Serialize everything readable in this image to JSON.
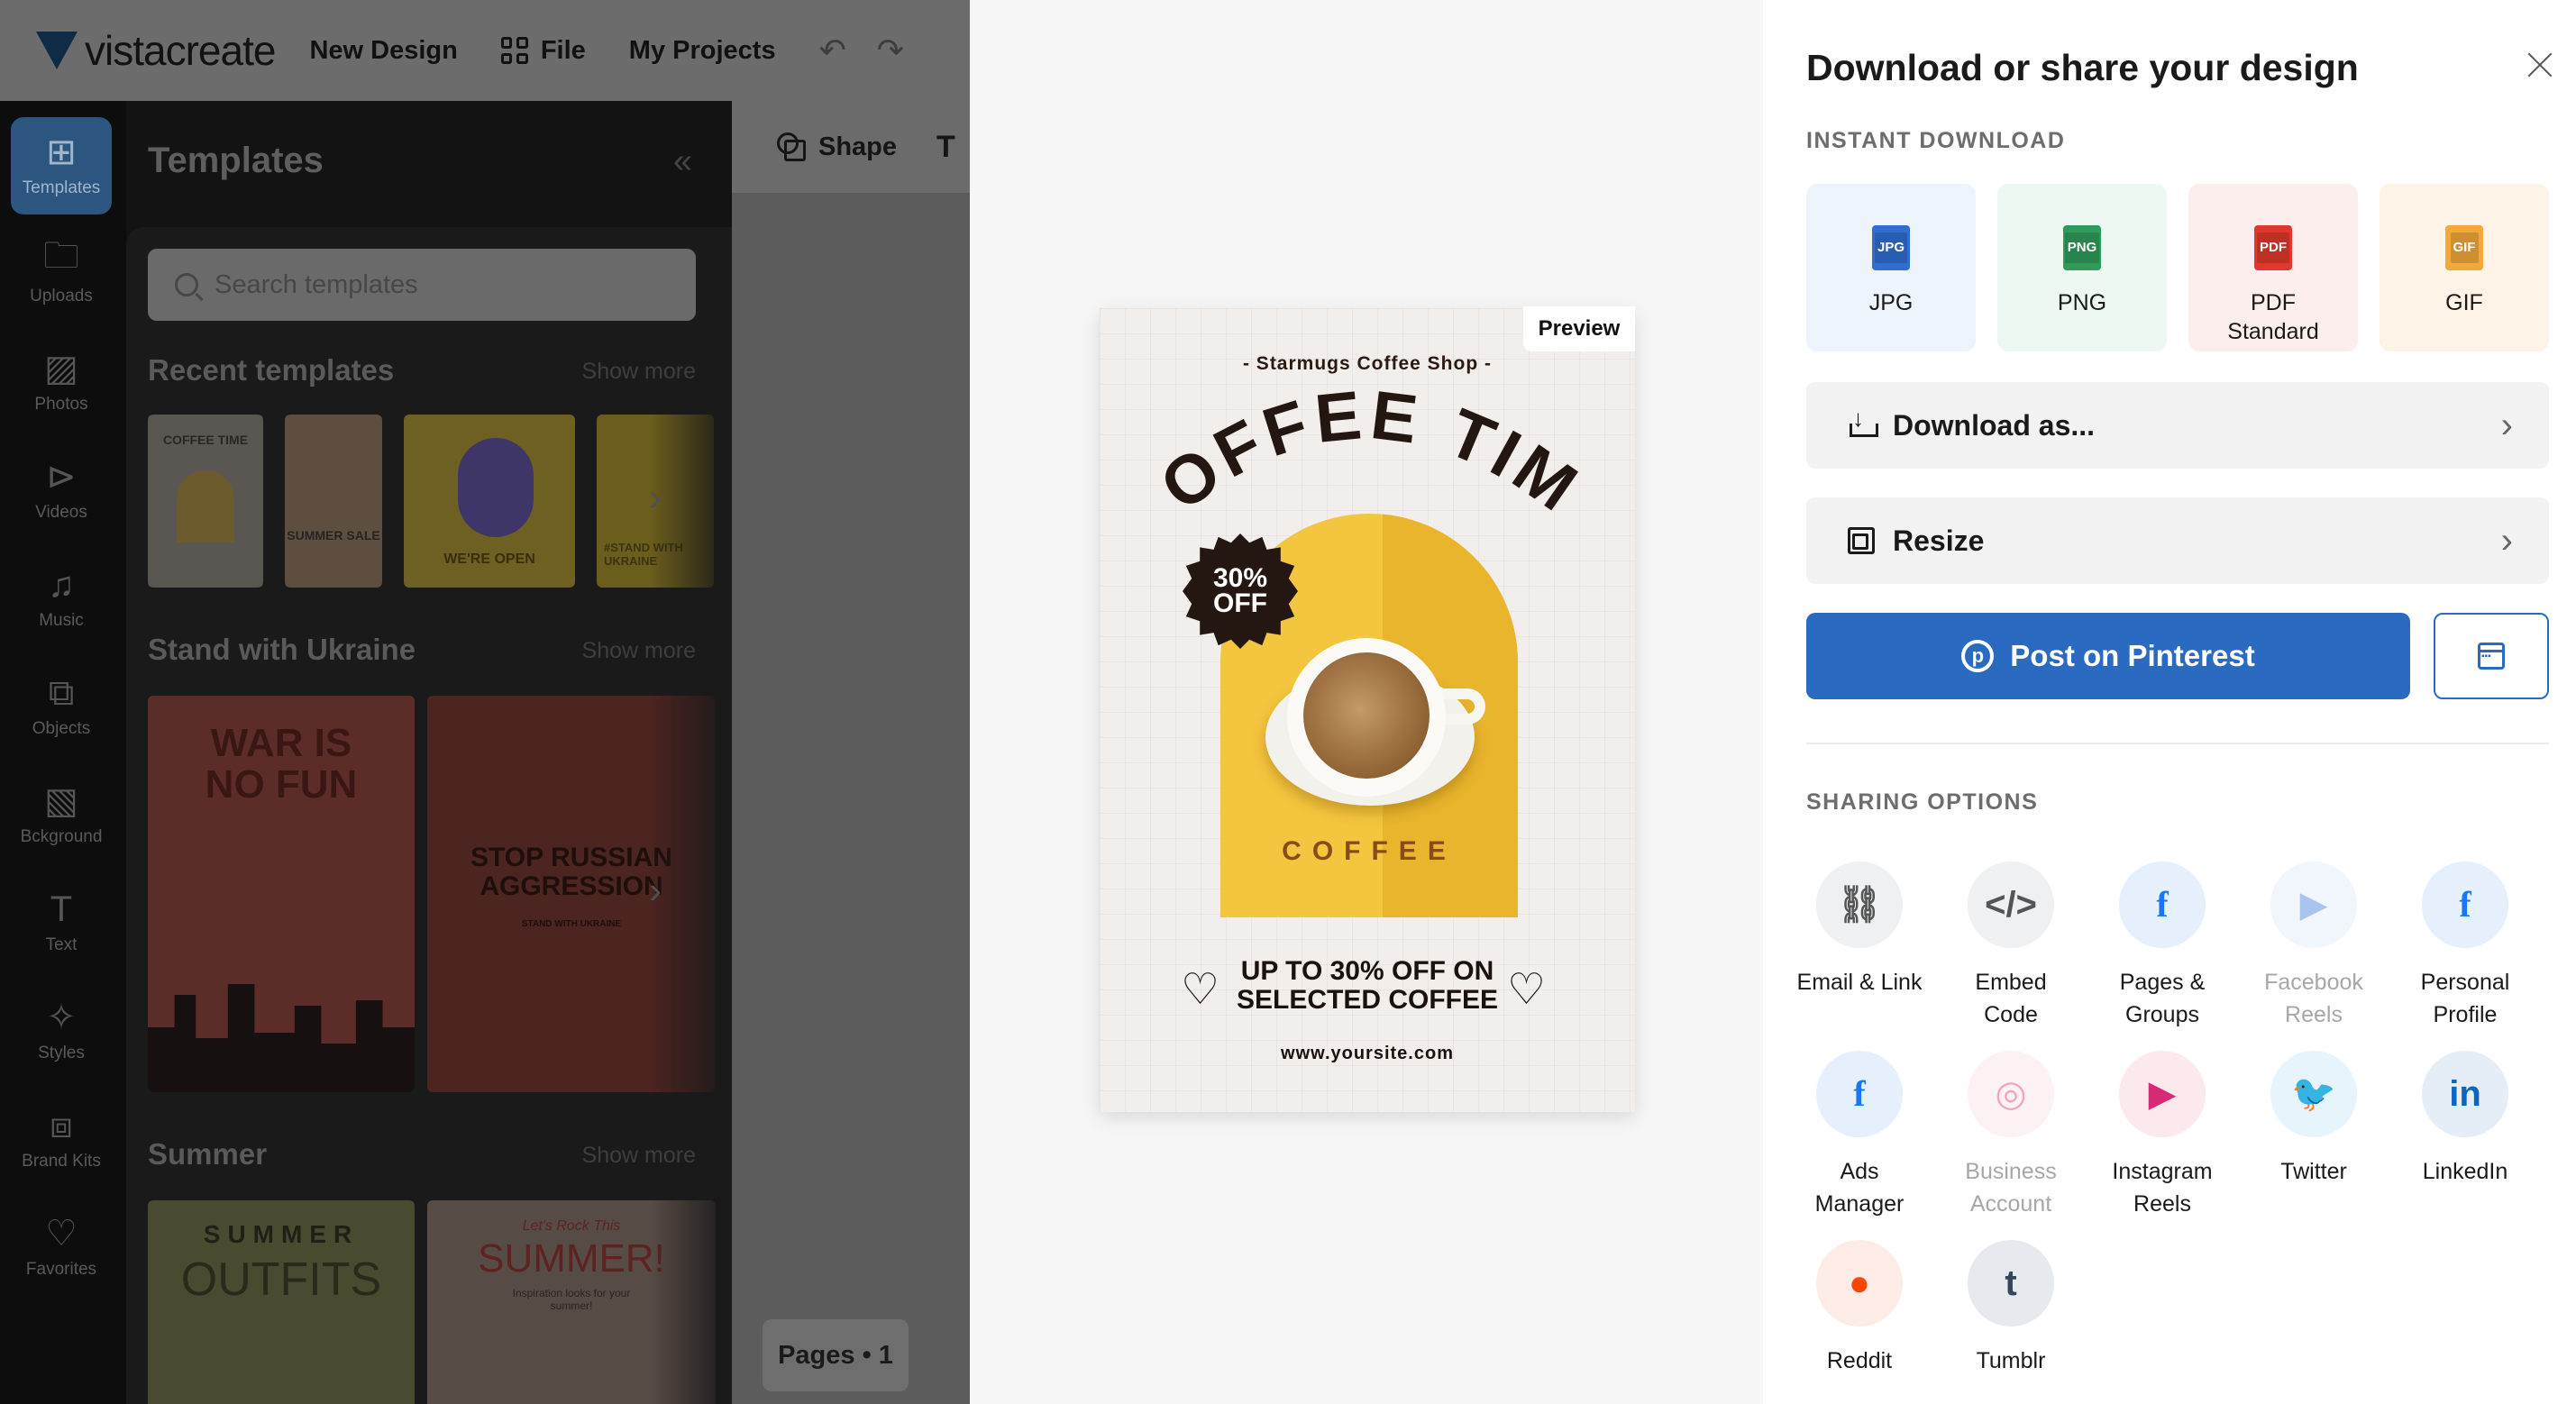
{
  "editor": {
    "logo_text": "vistacreate",
    "nav": {
      "new_design": "New Design",
      "file": "File",
      "my_projects": "My Projects"
    },
    "undo_icon": "undo-arrow-icon",
    "redo_icon": "redo-arrow-icon",
    "iconbar": [
      {
        "label": "Templates",
        "icon": "templates-icon",
        "active": true
      },
      {
        "label": "Uploads",
        "icon": "folder-icon"
      },
      {
        "label": "Photos",
        "icon": "image-icon"
      },
      {
        "label": "Videos",
        "icon": "video-icon"
      },
      {
        "label": "Music",
        "icon": "music-note-icon"
      },
      {
        "label": "Objects",
        "icon": "shapes-icon"
      },
      {
        "label": "Bckground",
        "icon": "background-icon"
      },
      {
        "label": "Text",
        "icon": "text-icon"
      },
      {
        "label": "Styles",
        "icon": "sparkle-icon"
      },
      {
        "label": "Brand Kits",
        "icon": "briefcase-icon"
      },
      {
        "label": "Favorites",
        "icon": "heart-icon"
      }
    ],
    "templates_panel": {
      "title": "Templates",
      "search_placeholder": "Search templates",
      "sections": [
        {
          "title": "Recent templates",
          "more": "Show more"
        },
        {
          "title": "Stand with Ukraine",
          "more": "Show more"
        },
        {
          "title": "Summer",
          "more": "Show more"
        }
      ],
      "recent_thumb_texts": [
        "COFFEE TIME",
        "SUMMER SALE",
        "WE'RE OPEN",
        "#STAND WITH UKRAINE"
      ],
      "ukraine_thumb_texts": [
        "WAR IS NO FUN",
        "STOP RUSSIAN AGGRESSION",
        "STAND WITH UKRAINE"
      ],
      "summer_thumb_texts": [
        "SUMMER",
        "OUTFITS",
        "Let's Rock This",
        "SUMMER!",
        "Inspiration looks for your summer!"
      ]
    },
    "toolbar": {
      "shape": "Shape"
    },
    "pages": "Pages • 1"
  },
  "preview": {
    "badge": "Preview",
    "poster": {
      "shop": "- Starmugs Coffee Shop -",
      "headline": "COFFEE TIME",
      "discount_line1": "30%",
      "discount_line2": "OFF",
      "arch_word": "COFFEE",
      "promo_line1": "UP TO 30% OFF ON",
      "promo_line2": "SELECTED COFFEE",
      "site": "www.yoursite.com"
    }
  },
  "share_panel": {
    "title": "Download or share your design",
    "instant_download_label": "INSTANT DOWNLOAD",
    "formats": [
      {
        "label": "JPG",
        "badge": "JPG",
        "bg": "#eef4fb",
        "icon_color": "#2f6fd0",
        "icon": "jpg-file-icon"
      },
      {
        "label": "PNG",
        "badge": "PNG",
        "bg": "#ecf8f1",
        "icon_color": "#2f9a5a",
        "icon": "png-file-icon"
      },
      {
        "label": "PDF\nStandard",
        "badge": "PDF",
        "bg": "#fdeeee",
        "icon_color": "#e0392b",
        "icon": "pdf-file-icon"
      },
      {
        "label": "GIF",
        "badge": "GIF",
        "bg": "#fdf3e6",
        "icon_color": "#f2a93b",
        "icon": "gif-file-icon"
      }
    ],
    "download_as": "Download as...",
    "resize": "Resize",
    "post_pinterest": "Post on Pinterest",
    "sharing_options_label": "SHARING OPTIONS",
    "share_options": [
      {
        "label": "Email & Link",
        "icon": "link-icon",
        "glyph": "⛓",
        "bg": "#eef0f2",
        "fg": "#555555",
        "dim": false
      },
      {
        "label": "Embed\nCode",
        "icon": "code-icon",
        "glyph": "</>",
        "bg": "#eef0f2",
        "fg": "#555555",
        "dim": false
      },
      {
        "label": "Pages &\nGroups",
        "icon": "facebook-icon",
        "glyph": "f",
        "bg": "#e6effc",
        "fg": "#1877f2",
        "dim": false
      },
      {
        "label": "Facebook\nReels",
        "icon": "facebook-reels-icon",
        "glyph": "▶",
        "bg": "#f1f5fc",
        "fg": "#a9c5ef",
        "dim": true
      },
      {
        "label": "Personal\nProfile",
        "icon": "facebook-icon",
        "glyph": "f",
        "bg": "#e6effc",
        "fg": "#1877f2",
        "dim": false
      },
      {
        "label": "Ads\nManager",
        "icon": "facebook-icon",
        "glyph": "f",
        "bg": "#e6effc",
        "fg": "#1877f2",
        "dim": false
      },
      {
        "label": "Business\nAccount",
        "icon": "instagram-icon",
        "glyph": "◎",
        "bg": "#fcf1f3",
        "fg": "#efa8b8",
        "dim": true
      },
      {
        "label": "Instagram\nReels",
        "icon": "instagram-reels-icon",
        "glyph": "▶",
        "bg": "#fbe9ee",
        "fg": "#d62976",
        "dim": false
      },
      {
        "label": "Twitter",
        "icon": "twitter-icon",
        "glyph": "🐦",
        "bg": "#e8f4fc",
        "fg": "#1da1f2",
        "dim": false
      },
      {
        "label": "LinkedIn",
        "icon": "linkedin-icon",
        "glyph": "in",
        "bg": "#e5eef6",
        "fg": "#0a66c2",
        "dim": false
      },
      {
        "label": "Reddit",
        "icon": "reddit-icon",
        "glyph": "●",
        "bg": "#fdece6",
        "fg": "#ff4500",
        "dim": false
      },
      {
        "label": "Tumblr",
        "icon": "tumblr-icon",
        "glyph": "t",
        "bg": "#e6e9ee",
        "fg": "#35465c",
        "dim": false
      }
    ]
  }
}
